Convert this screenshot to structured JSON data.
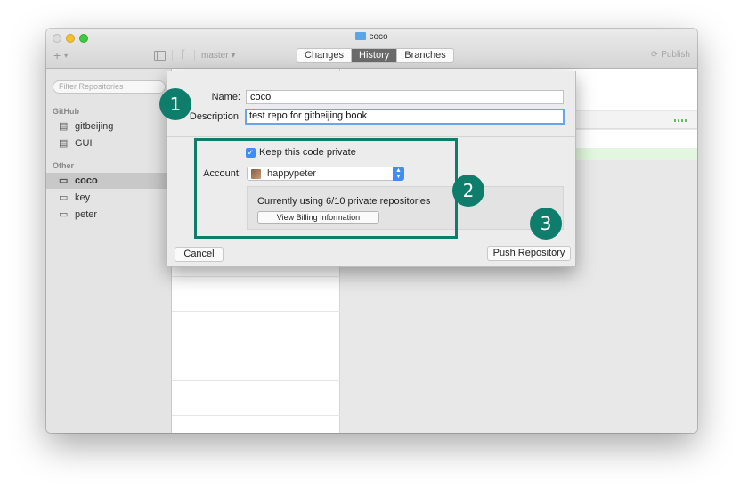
{
  "window": {
    "title": "coco"
  },
  "toolbar": {
    "add_symbol": "+",
    "branch": "master ▾",
    "tabs": [
      {
        "label": "Changes"
      },
      {
        "label": "History"
      },
      {
        "label": "Branches"
      }
    ],
    "active_tab": "History",
    "publish": "Publish"
  },
  "sidebar": {
    "filter_placeholder": "Filter Repositories",
    "groups": [
      {
        "label": "GitHub",
        "items": [
          {
            "label": "gitbeijing",
            "icon": "book-icon"
          },
          {
            "label": "GUI",
            "icon": "book-icon"
          }
        ]
      },
      {
        "label": "Other",
        "items": [
          {
            "label": "coco",
            "icon": "computer-icon"
          },
          {
            "label": "key",
            "icon": "computer-icon"
          },
          {
            "label": "peter",
            "icon": "computer-icon"
          }
        ]
      }
    ],
    "selected": "coco"
  },
  "dialog": {
    "name_label": "Name:",
    "name_value": "coco",
    "description_label": "Description:",
    "description_value": "test repo for gitbeijing book",
    "private_checked": true,
    "private_label": "Keep this code private",
    "account_label": "Account:",
    "account_value": "happypeter",
    "usage_text": "Currently using 6/10 private repositories",
    "billing_button": "View Billing Information",
    "cancel_button": "Cancel",
    "push_button": "Push Repository"
  },
  "annotations": {
    "badge1": "1",
    "badge2": "2",
    "badge3": "3"
  },
  "colors": {
    "annotation": "#0e7d6b",
    "focus_ring": "#6aa5e8",
    "checkbox": "#3f8ef2",
    "active_tab": "#6a6a6a"
  }
}
